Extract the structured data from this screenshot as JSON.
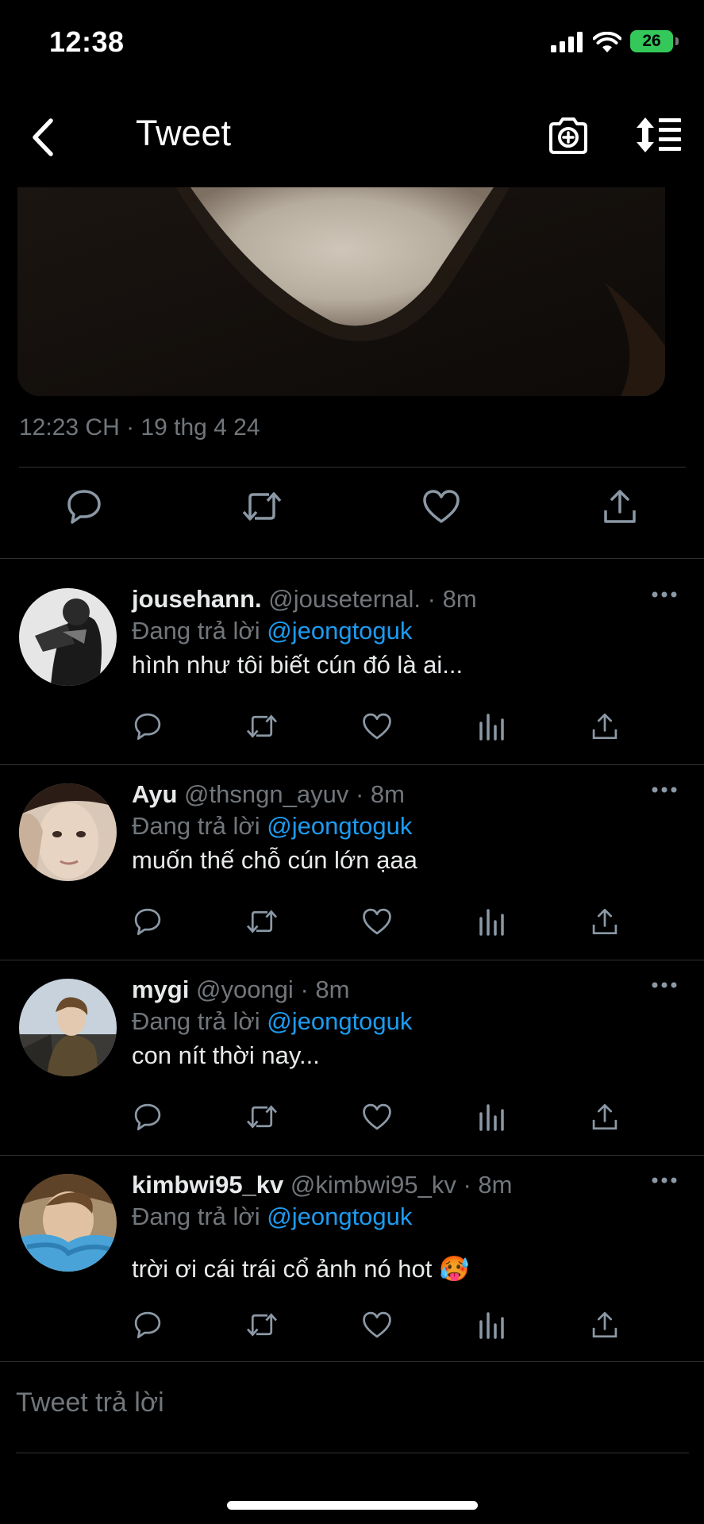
{
  "status_bar": {
    "time": "12:38",
    "battery": "26"
  },
  "nav": {
    "title": "Tweet",
    "back_icon": "chevron-left-icon",
    "camera_icon": "camera-plus-icon",
    "sort_icon": "sort-icon"
  },
  "tweet": {
    "timestamp": "12:23 CH · 19 thg 4 24"
  },
  "replies": [
    {
      "name": "jousehann.",
      "handle": "@jouseternal.",
      "time": "8m",
      "replying_label": "Đang trả lời",
      "mention": "@jeongtoguk",
      "text": "hình như tôi biết cún đó là ai..."
    },
    {
      "name": "Ayu",
      "handle": "@thsngn_ayuv",
      "time": "8m",
      "replying_label": "Đang trả lời",
      "mention": "@jeongtoguk",
      "text": "muốn thế chỗ cún lớn ạaa"
    },
    {
      "name": "mygi",
      "handle": "@yoongi",
      "time": "8m",
      "replying_label": "Đang trả lời",
      "mention": "@jeongtoguk",
      "text": "con nít thời nay..."
    },
    {
      "name": "kimbwi95_kv",
      "handle": "@kimbwi95_kv",
      "time": "8m",
      "replying_label": "Đang trả lời",
      "mention": "@jeongtoguk",
      "text": "trời ơi cái trái cổ ảnh nó hot 🥵"
    }
  ],
  "composer": {
    "placeholder": "Tweet trả lời"
  },
  "colors": {
    "background": "#000000",
    "text": "#e7e9ea",
    "muted": "#71767b",
    "accent": "#1d9bf0",
    "battery": "#34c759"
  }
}
